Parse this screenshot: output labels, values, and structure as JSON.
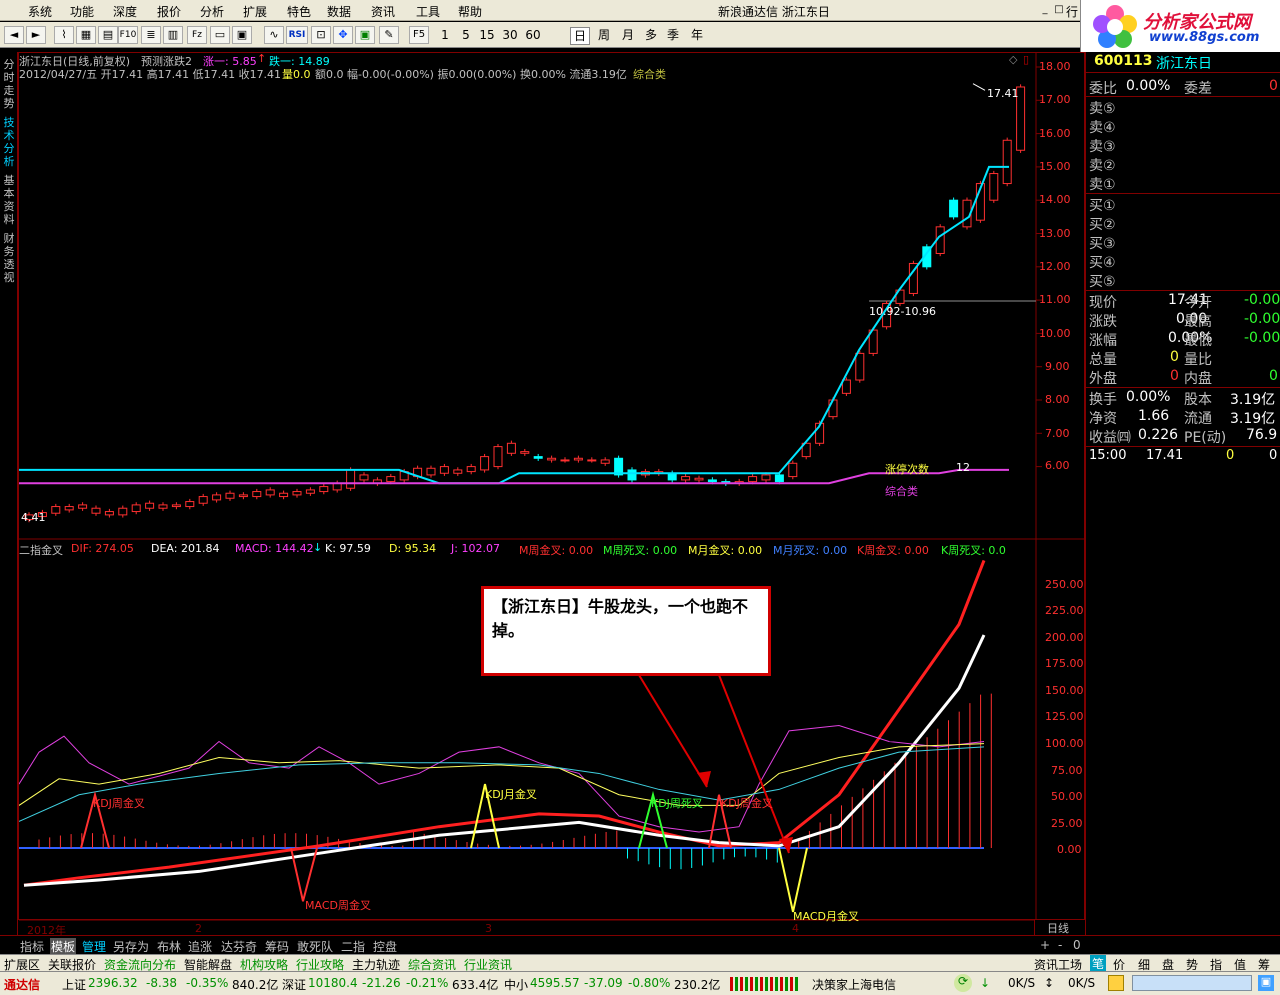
{
  "window": {
    "title": "新浪通达信   浙江东日",
    "min": "_",
    "max": "□"
  },
  "menu": [
    "系统",
    "功能",
    "深度",
    "报价",
    "分析",
    "扩展",
    "特色",
    "数据",
    "资讯",
    "工具",
    "帮助"
  ],
  "menu_extra": "行",
  "toolbar": {
    "buttons": [
      "F10",
      "Fz",
      "RSI",
      "F5"
    ],
    "periods": [
      "1",
      "5",
      "15",
      "30",
      "60",
      "日",
      "周",
      "月",
      "多",
      "季",
      "年"
    ],
    "selected_period": "日"
  },
  "logo": {
    "line1": "分析家公式网",
    "line2": "www.88gs.com"
  },
  "side_tabs": [
    "分时走势",
    "技术分析",
    "基本资料",
    "财务透视"
  ],
  "chart": {
    "title": "浙江东日(日线,前复权)",
    "formula": "预测涨跌2",
    "up_label": "涨一: 5.85",
    "down_label": "跌一: 14.89",
    "info": "2012/04/27/五 开17.41 高17.41 低17.41 收17.41",
    "vol": "量0.0",
    "info2": "额0.0 幅-0.00(-0.00%) 振0.00(0.00%) 换0.00% 流通3.19亿",
    "sector": "综合类",
    "high_label": "17.41",
    "low_label": "4.41",
    "range_label": "10.92-10.96",
    "limit_label": "涨停次数",
    "limit_value": "12",
    "sector_line_label": "综合类",
    "price_axis": [
      "18.00",
      "17.00",
      "16.00",
      "15.00",
      "14.00",
      "13.00",
      "12.00",
      "11.00",
      "10.00",
      "9.00",
      "8.00",
      "7.00",
      "6.00"
    ],
    "price_range": [
      4.0,
      18.5
    ]
  },
  "indicator": {
    "name": "二指金叉",
    "items": [
      {
        "label": "DIF: 274.05",
        "color": "#ff3030"
      },
      {
        "label": "DEA: 201.84",
        "color": "#ffffff"
      },
      {
        "label": "MACD: 144.42",
        "color": "#ff40ff"
      },
      {
        "label": "K: 97.59",
        "color": "#ffffff"
      },
      {
        "label": "D: 95.34",
        "color": "#ffff40"
      },
      {
        "label": "J: 102.07",
        "color": "#ff40ff"
      },
      {
        "label": "M周金叉: 0.00",
        "color": "#ff3030"
      },
      {
        "label": "M周死叉: 0.00",
        "color": "#30ff30"
      },
      {
        "label": "M月金叉: 0.00",
        "color": "#ffff40"
      },
      {
        "label": "M月死叉: 0.00",
        "color": "#4080ff"
      },
      {
        "label": "K周金叉: 0.00",
        "color": "#ff3030"
      },
      {
        "label": "K周死叉: 0.0",
        "color": "#30ff30"
      }
    ],
    "axis": [
      "250.00",
      "225.00",
      "200.00",
      "175.00",
      "150.00",
      "125.00",
      "100.00",
      "75.00",
      "50.00",
      "25.00",
      "0.00"
    ],
    "signals": {
      "kdj_week_gold_1": "KDJ周金叉",
      "macd_week_gold": "MACD周金叉",
      "kdj_month_gold": "KDJ月金叉",
      "kdj_week_dead": "KDJ周死叉",
      "kdj_week_gold_2": "KDJ周金叉",
      "macd_month_gold": "MACD月金叉"
    },
    "annotation": "【浙江东日】牛股龙头，一个也跑不掉。"
  },
  "time_axis": [
    "2012年",
    "2",
    "3",
    "4"
  ],
  "time_mark": "日线",
  "quote": {
    "code": "600113",
    "name": "浙江东日",
    "wb_label": "委比",
    "wb_value": "0.00%",
    "wc_label": "委差",
    "wc_value": "0",
    "sells": [
      "卖⑤",
      "卖④",
      "卖③",
      "卖②",
      "卖①"
    ],
    "buys": [
      "买①",
      "买②",
      "买③",
      "买④",
      "买⑤"
    ],
    "rows": [
      {
        "l1": "现价",
        "v1": "17.41",
        "l2": "今开",
        "v2": "-0.00",
        "c1": "#ffffff",
        "c2": "#30ff30"
      },
      {
        "l1": "涨跌",
        "v1": "0.00",
        "l2": "最高",
        "v2": "-0.00",
        "c1": "#ffffff",
        "c2": "#30ff30"
      },
      {
        "l1": "涨幅",
        "v1": "0.00%",
        "l2": "最低",
        "v2": "-0.00",
        "c1": "#ffffff",
        "c2": "#30ff30"
      },
      {
        "l1": "总量",
        "v1": "0",
        "l2": "量比",
        "v2": "",
        "c1": "#ffff40",
        "c2": "#ffffff"
      },
      {
        "l1": "外盘",
        "v1": "0",
        "l2": "内盘",
        "v2": "0",
        "c1": "#ff3030",
        "c2": "#30ff30"
      },
      {
        "l1": "换手",
        "v1": "0.00%",
        "l2": "股本",
        "v2": "3.19亿",
        "c1": "#ffffff",
        "c2": "#ffffff"
      },
      {
        "l1": "净资",
        "v1": "1.66",
        "l2": "流通",
        "v2": "3.19亿",
        "c1": "#ffffff",
        "c2": "#ffffff"
      },
      {
        "l1": "收益㈣",
        "v1": "0.226",
        "l2": "PE(动)",
        "v2": "76.9",
        "c1": "#ffffff",
        "c2": "#ffffff"
      }
    ],
    "tick_time": "15:00",
    "tick_price": "17.41",
    "tick_vol": "0",
    "tick_flag": "0"
  },
  "bottom_tabs": [
    "指标",
    "模板",
    "管理",
    "另存为",
    "布林",
    "追涨",
    "达芬奇",
    "筹码",
    "敢死队",
    "二指",
    "控盘"
  ],
  "bottom_tab_active": "模板",
  "bottom_tab_highlight": "管理",
  "right_nav": [
    "笔",
    "价",
    "细",
    "盘",
    "势",
    "指",
    "值",
    "筹"
  ],
  "right_nav_small": [
    "+",
    "-",
    "0"
  ],
  "ext_bar": {
    "first": "扩展区",
    "items": [
      "关联报价",
      "资金流向分布",
      "智能解盘",
      "机构攻略",
      "行业攻略",
      "主力轨迹",
      "综合资讯",
      "行业资讯"
    ],
    "right": "资讯工场"
  },
  "status": {
    "brand": "通达信",
    "sh_label": "上证",
    "sh": "2396.32",
    "sh_chg": "-8.38",
    "sh_pct": "-0.35%",
    "sh_amt": "840.2亿",
    "sz_label": "深证",
    "sz": "10180.4",
    "sz_chg": "-21.26",
    "sz_pct": "-0.21%",
    "sz_amt": "633.4亿",
    "zx_label": "中小",
    "zx": "4595.57",
    "zx_chg": "-37.09",
    "zx_pct": "-0.80%",
    "zx_amt": "230.2亿",
    "broker": "决策家上海电信",
    "speed1": "0K/S",
    "speed2": "0K/S"
  },
  "colors": {
    "up": "#ff3030",
    "down": "#00ffff",
    "bg": "#000000",
    "frame": "#800000",
    "support": "#00e5ff",
    "sector": "#e040e0"
  }
}
